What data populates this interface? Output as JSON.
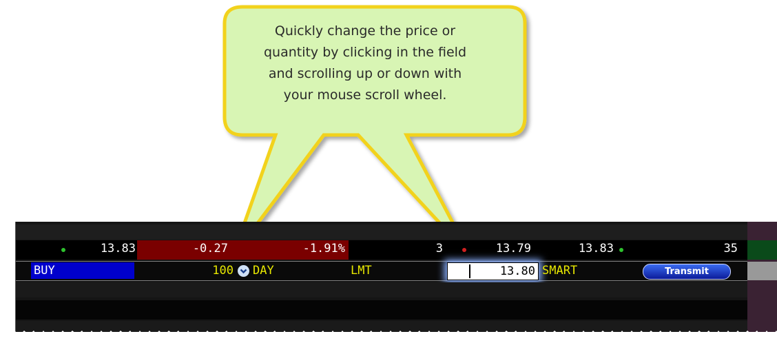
{
  "callout": {
    "lines": [
      "Quickly change the price or",
      "quantity by clicking in the field",
      "and scrolling up or down with",
      "your mouse scroll wheel."
    ]
  },
  "market_row": {
    "bid_size_dot": "green",
    "last": "13.83",
    "change": "-0.27",
    "change_pct": "-1.91%",
    "bid_size": "3",
    "bid": "13.79",
    "ask": "13.83",
    "ask_size": "35"
  },
  "order_row": {
    "action": "BUY",
    "quantity": "100",
    "time_in_force": "DAY",
    "order_type": "LMT",
    "limit_price": "13.80",
    "destination": "SMART",
    "transmit_label": "Transmit"
  },
  "colors": {
    "callout_fill": "#d8f5b4",
    "callout_border": "#f2d21c",
    "buy_blue": "#0000cc",
    "change_red": "#7a0000",
    "order_yellow": "#e8e800"
  }
}
